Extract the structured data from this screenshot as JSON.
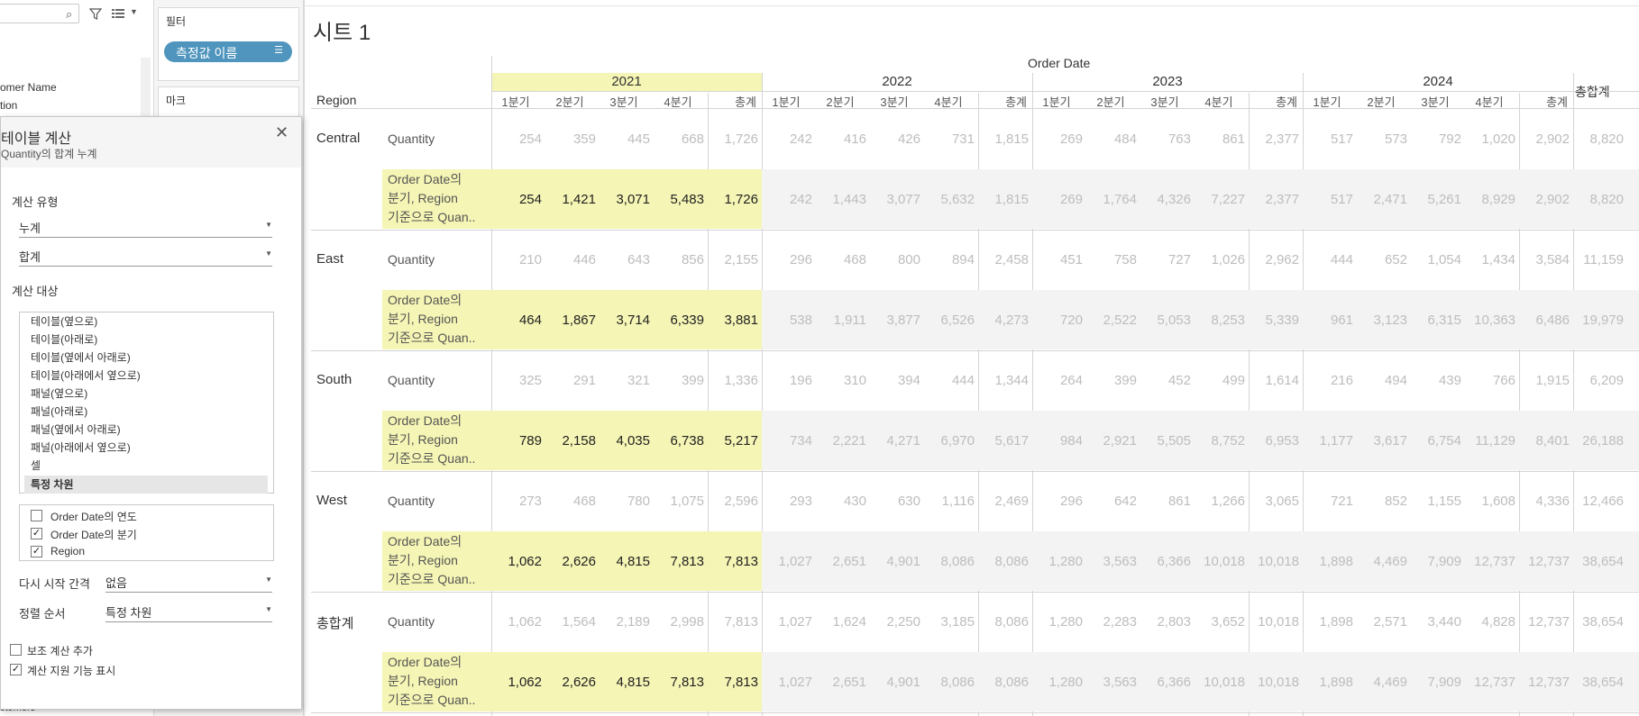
{
  "data_pane": {
    "fields": [
      "omer Name",
      "tion"
    ],
    "bottom_field": "stomers"
  },
  "shelves": {
    "filters_title": "필터",
    "filter_pill": "측정값 이름",
    "marks_title": "마크"
  },
  "calc_dialog": {
    "title": "테이블 계산",
    "subtitle": "Quantity의 합계 누계",
    "calc_type_label": "계산 유형",
    "calc_type_value": "누계",
    "aggregation_value": "합계",
    "compute_using_label": "계산 대상",
    "compute_options": [
      "테이블(옆으로)",
      "테이블(아래로)",
      "테이블(옆에서 아래로)",
      "테이블(아래에서 옆으로)",
      "패널(옆으로)",
      "패널(아래로)",
      "패널(옆에서 아래로)",
      "패널(아래에서 옆으로)",
      "셀",
      "특정 차원"
    ],
    "selected_option": "특정 차원",
    "dimensions": [
      {
        "label": "Order Date의 연도",
        "checked": false
      },
      {
        "label": "Order Date의 분기",
        "checked": true
      },
      {
        "label": "Region",
        "checked": true
      }
    ],
    "restart_label": "다시 시작 간격",
    "restart_value": "없음",
    "sort_label": "정렬 순서",
    "sort_value": "특정 차원",
    "secondary_calc_label": "보조 계산 추가",
    "secondary_calc_checked": false,
    "show_assist_label": "계산 지원 기능 표시",
    "show_assist_checked": true
  },
  "sheet": {
    "title": "시트 1",
    "column_header": "Order Date",
    "row_header": "Region",
    "years": [
      "2021",
      "2022",
      "2023",
      "2024"
    ],
    "quarters": [
      "1분기",
      "2분기",
      "3분기",
      "4분기",
      "총계"
    ],
    "grand_total_label": "총합계",
    "measure_label": "Quantity",
    "calc_measure_lines": [
      "Order Date의",
      "분기, Region",
      "기준으로 Quan.."
    ],
    "highlight_color": "#f5f5b5",
    "regions": [
      {
        "name": "Central",
        "quantity": [
          "254",
          "359",
          "445",
          "668",
          "1,726",
          "242",
          "416",
          "426",
          "731",
          "1,815",
          "269",
          "484",
          "763",
          "861",
          "2,377",
          "517",
          "573",
          "792",
          "1,020",
          "2,902",
          "8,820"
        ],
        "running": [
          "254",
          "1,421",
          "3,071",
          "5,483",
          "1,726",
          "242",
          "1,443",
          "3,077",
          "5,632",
          "1,815",
          "269",
          "1,764",
          "4,326",
          "7,227",
          "2,377",
          "517",
          "2,471",
          "5,261",
          "8,929",
          "2,902",
          "8,820"
        ]
      },
      {
        "name": "East",
        "quantity": [
          "210",
          "446",
          "643",
          "856",
          "2,155",
          "296",
          "468",
          "800",
          "894",
          "2,458",
          "451",
          "758",
          "727",
          "1,026",
          "2,962",
          "444",
          "652",
          "1,054",
          "1,434",
          "3,584",
          "11,159"
        ],
        "running": [
          "464",
          "1,867",
          "3,714",
          "6,339",
          "3,881",
          "538",
          "1,911",
          "3,877",
          "6,526",
          "4,273",
          "720",
          "2,522",
          "5,053",
          "8,253",
          "5,339",
          "961",
          "3,123",
          "6,315",
          "10,363",
          "6,486",
          "19,979"
        ]
      },
      {
        "name": "South",
        "quantity": [
          "325",
          "291",
          "321",
          "399",
          "1,336",
          "196",
          "310",
          "394",
          "444",
          "1,344",
          "264",
          "399",
          "452",
          "499",
          "1,614",
          "216",
          "494",
          "439",
          "766",
          "1,915",
          "6,209"
        ],
        "running": [
          "789",
          "2,158",
          "4,035",
          "6,738",
          "5,217",
          "734",
          "2,221",
          "4,271",
          "6,970",
          "5,617",
          "984",
          "2,921",
          "5,505",
          "8,752",
          "6,953",
          "1,177",
          "3,617",
          "6,754",
          "11,129",
          "8,401",
          "26,188"
        ]
      },
      {
        "name": "West",
        "quantity": [
          "273",
          "468",
          "780",
          "1,075",
          "2,596",
          "293",
          "430",
          "630",
          "1,116",
          "2,469",
          "296",
          "642",
          "861",
          "1,266",
          "3,065",
          "721",
          "852",
          "1,155",
          "1,608",
          "4,336",
          "12,466"
        ],
        "running": [
          "1,062",
          "2,626",
          "4,815",
          "7,813",
          "7,813",
          "1,027",
          "2,651",
          "4,901",
          "8,086",
          "8,086",
          "1,280",
          "3,563",
          "6,366",
          "10,018",
          "10,018",
          "1,898",
          "4,469",
          "7,909",
          "12,737",
          "12,737",
          "38,654"
        ]
      },
      {
        "name": "총합계",
        "quantity": [
          "1,062",
          "1,564",
          "2,189",
          "2,998",
          "7,813",
          "1,027",
          "1,624",
          "2,250",
          "3,185",
          "8,086",
          "1,280",
          "2,283",
          "2,803",
          "3,652",
          "10,018",
          "1,898",
          "2,571",
          "3,440",
          "4,828",
          "12,737",
          "38,654"
        ],
        "running": [
          "1,062",
          "2,626",
          "4,815",
          "7,813",
          "7,813",
          "1,027",
          "2,651",
          "4,901",
          "8,086",
          "8,086",
          "1,280",
          "3,563",
          "6,366",
          "10,018",
          "10,018",
          "1,898",
          "4,469",
          "7,909",
          "12,737",
          "12,737",
          "38,654"
        ]
      }
    ]
  }
}
